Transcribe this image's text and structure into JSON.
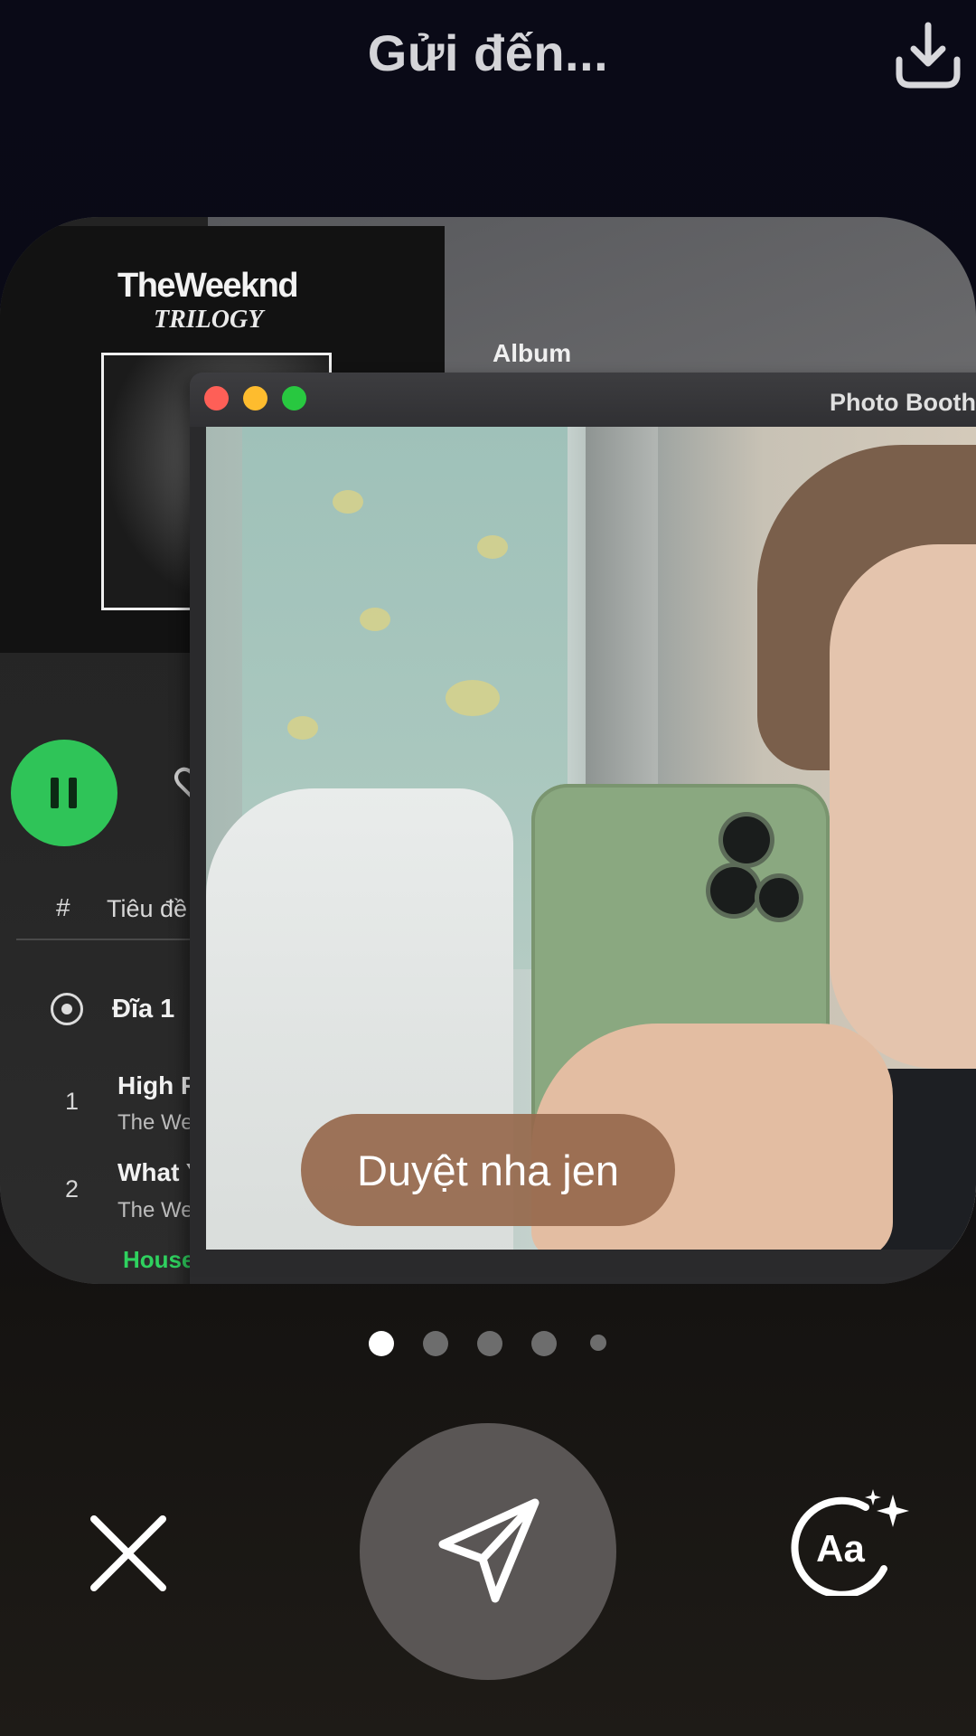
{
  "header": {
    "title": "Gửi đến...",
    "download_icon": "download-icon"
  },
  "preview": {
    "spotify": {
      "artist": "TheWeeknd",
      "album_title": "TRILOGY",
      "section_label": "Album",
      "column_hash": "#",
      "column_title": "Tiêu đề",
      "disc_label": "Đĩa 1",
      "tracks": [
        {
          "number": "1",
          "title": "High Fo",
          "artist": "The Wee"
        },
        {
          "number": "2",
          "title": "What Y",
          "artist": "The Wee"
        }
      ],
      "playing_track": "House",
      "accent_color": "#2fc458"
    },
    "photo_booth": {
      "window_title": "Photo Booth"
    },
    "caption": "Duyệt nha jen"
  },
  "pagination": {
    "count": 5,
    "active_index": 0
  },
  "controls": {
    "close_icon": "close-icon",
    "send_icon": "send-icon",
    "text_style_icon": "text-style-icon"
  }
}
